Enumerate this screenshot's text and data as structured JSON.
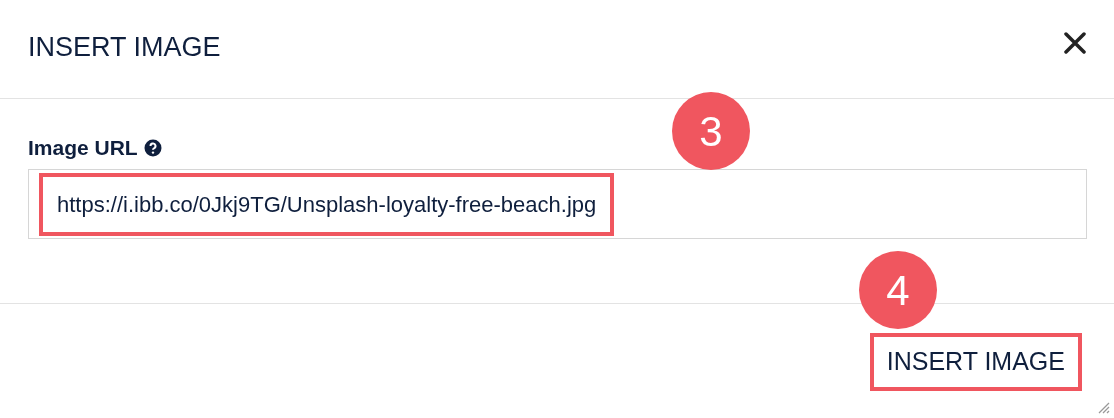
{
  "dialog": {
    "title": "INSERT IMAGE"
  },
  "field": {
    "label": "Image URL",
    "value": "https://i.ibb.co/0Jkj9TG/Unsplash-loyalty-free-beach.jpg",
    "highlighted": true
  },
  "annotations": [
    {
      "number": "3"
    },
    {
      "number": "4"
    }
  ],
  "button": {
    "label": "INSERT IMAGE",
    "highlighted": true
  }
}
